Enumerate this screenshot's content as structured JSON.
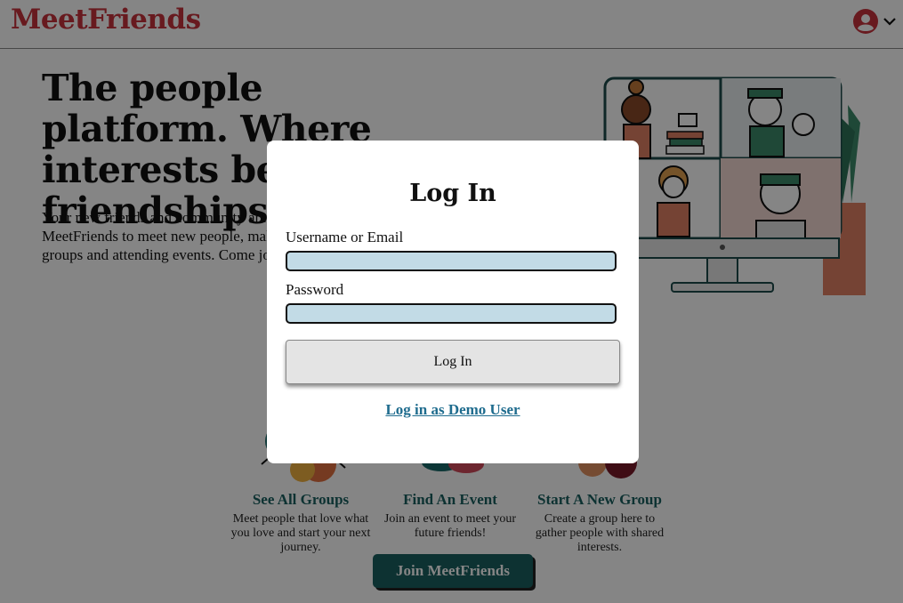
{
  "header": {
    "logo": "MeetFriends",
    "icons": {
      "avatar": "user-circle-icon",
      "menu": "chevron-down-icon"
    }
  },
  "hero": {
    "title": "The people platform. Where interests become friendships.",
    "description": "Your new friends and community are waiting for you! People have chosen MeetFriends to meet new people, make friends and connections through joining groups and attending events. Come join us and start a new journey!"
  },
  "features": [
    {
      "title": "See All Groups",
      "description": "Meet people that love what you love and start your next journey."
    },
    {
      "title": "Find An Event",
      "description": "Join an event to meet your future friends!"
    },
    {
      "title": "Start A New Group",
      "description": "Create a group here to gather people with shared interests."
    }
  ],
  "join_button": "Join MeetFriends",
  "modal": {
    "title": "Log In",
    "username_label": "Username or Email",
    "username_value": "",
    "password_label": "Password",
    "password_value": "",
    "submit_label": "Log In",
    "demo_link": "Log in as Demo User"
  },
  "colors": {
    "brand": "#c8323c",
    "teal": "#1a6060",
    "input_bg": "#c2dbe6",
    "link": "#1f6c8e",
    "overlay": "rgba(0,0,0,0.48)"
  }
}
